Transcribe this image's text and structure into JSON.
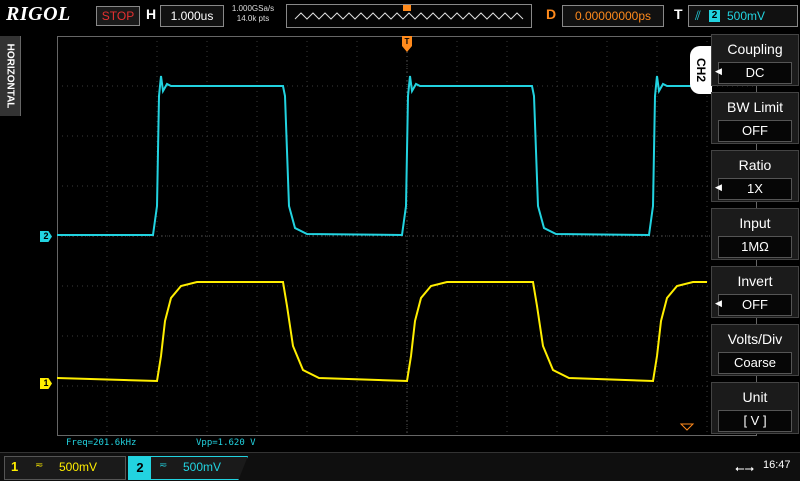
{
  "brand": "RIGOL",
  "run_state": "STOP",
  "horizontal": {
    "label": "H",
    "timebase": "1.000us",
    "sample_rate": "1.000GSa/s",
    "mem_depth": "14.0k pts"
  },
  "delay": {
    "label": "D",
    "value": "0.00000000ps"
  },
  "trigger": {
    "label": "T",
    "edge_icon": "rising-edge-icon",
    "source": "2",
    "level": "500mV"
  },
  "side_tab": "HORIZONTAL",
  "menu": {
    "channel_tab": "CH2",
    "items": [
      {
        "title": "Coupling",
        "value": "DC"
      },
      {
        "title": "BW Limit",
        "value": "OFF"
      },
      {
        "title": "Ratio",
        "value": "1X"
      },
      {
        "title": "Input",
        "value": "1MΩ"
      },
      {
        "title": "Invert",
        "value": "OFF"
      },
      {
        "title": "Volts/Div",
        "value": "Coarse"
      },
      {
        "title": "Unit",
        "value": "[  V  ]"
      }
    ]
  },
  "measurements": {
    "freq": "Freq=201.6kHz",
    "vpp": "Vpp=1.620 V"
  },
  "channels": [
    {
      "num": "1",
      "coupling": "≂",
      "scale": "500mV",
      "color": "#ffee00"
    },
    {
      "num": "2",
      "coupling": "≂",
      "scale": "500mV",
      "color": "#22d3e0"
    }
  ],
  "markers": {
    "ch1": "1",
    "ch2": "2",
    "trig": "T"
  },
  "clock": "16:47",
  "colors": {
    "ch1": "#ffee00",
    "ch2": "#22d3e0",
    "accent": "#ff8a1c",
    "stop": "#e53030"
  }
}
